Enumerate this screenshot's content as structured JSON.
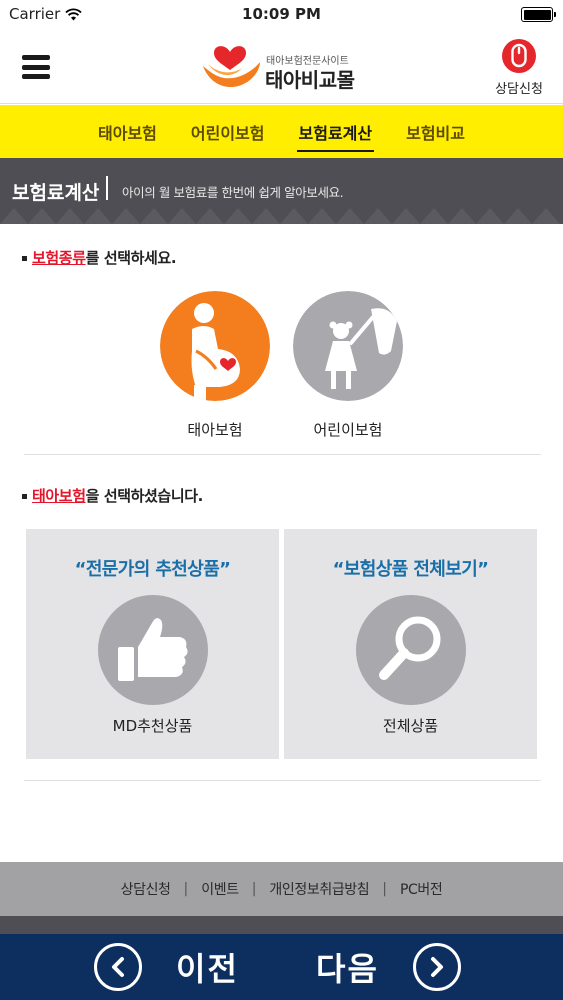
{
  "status_bar": {
    "carrier": "Carrier",
    "time": "10:09 PM"
  },
  "header": {
    "logo_subtitle": "태아보험전문사이트",
    "logo_name": "태아비교몰",
    "consult_label": "상담신청",
    "menu_icon": "hamburger-icon",
    "consult_icon": "mouse-icon"
  },
  "top_nav": {
    "items": [
      {
        "label": "태아보험",
        "active": false
      },
      {
        "label": "어린이보험",
        "active": false
      },
      {
        "label": "보험료계산",
        "active": true
      },
      {
        "label": "보험비교",
        "active": false
      }
    ]
  },
  "banner": {
    "title": "보험료계산",
    "separator": "|",
    "description": "아이의 월 보험료를 한번에 쉽게 알아보세요."
  },
  "section1": {
    "highlight": "보험종류",
    "rest": "를 선택하세요.",
    "choices": [
      {
        "label": "태아보험",
        "selected": true,
        "icon": "pregnant-woman-icon"
      },
      {
        "label": "어린이보험",
        "selected": false,
        "icon": "child-icon"
      }
    ]
  },
  "section2": {
    "highlight": "태아보험",
    "rest": "을 선택하셨습니다.",
    "cards": [
      {
        "title": "“전문가의 추천상품”",
        "label": "MD추천상품",
        "icon": "thumbs-up-icon"
      },
      {
        "title": "“보험상품 전체보기”",
        "label": "전체상품",
        "icon": "magnifier-icon"
      }
    ]
  },
  "footer": {
    "links": [
      "상담신청",
      "이벤트",
      "개인정보취급방침",
      "PC버전"
    ],
    "separator": "|"
  },
  "bottom_nav": {
    "prev_label": "이전",
    "next_label": "다음",
    "prev_icon": "chevron-left-icon",
    "next_icon": "chevron-right-icon"
  },
  "colors": {
    "yellow_nav": "#ffee00",
    "banner_dark": "#4e4e54",
    "accent_red": "#e4162b",
    "orange_selected": "#f47d1e",
    "card_title_blue": "#1b6fa8",
    "bottom_nav_navy": "#0d2f60"
  }
}
